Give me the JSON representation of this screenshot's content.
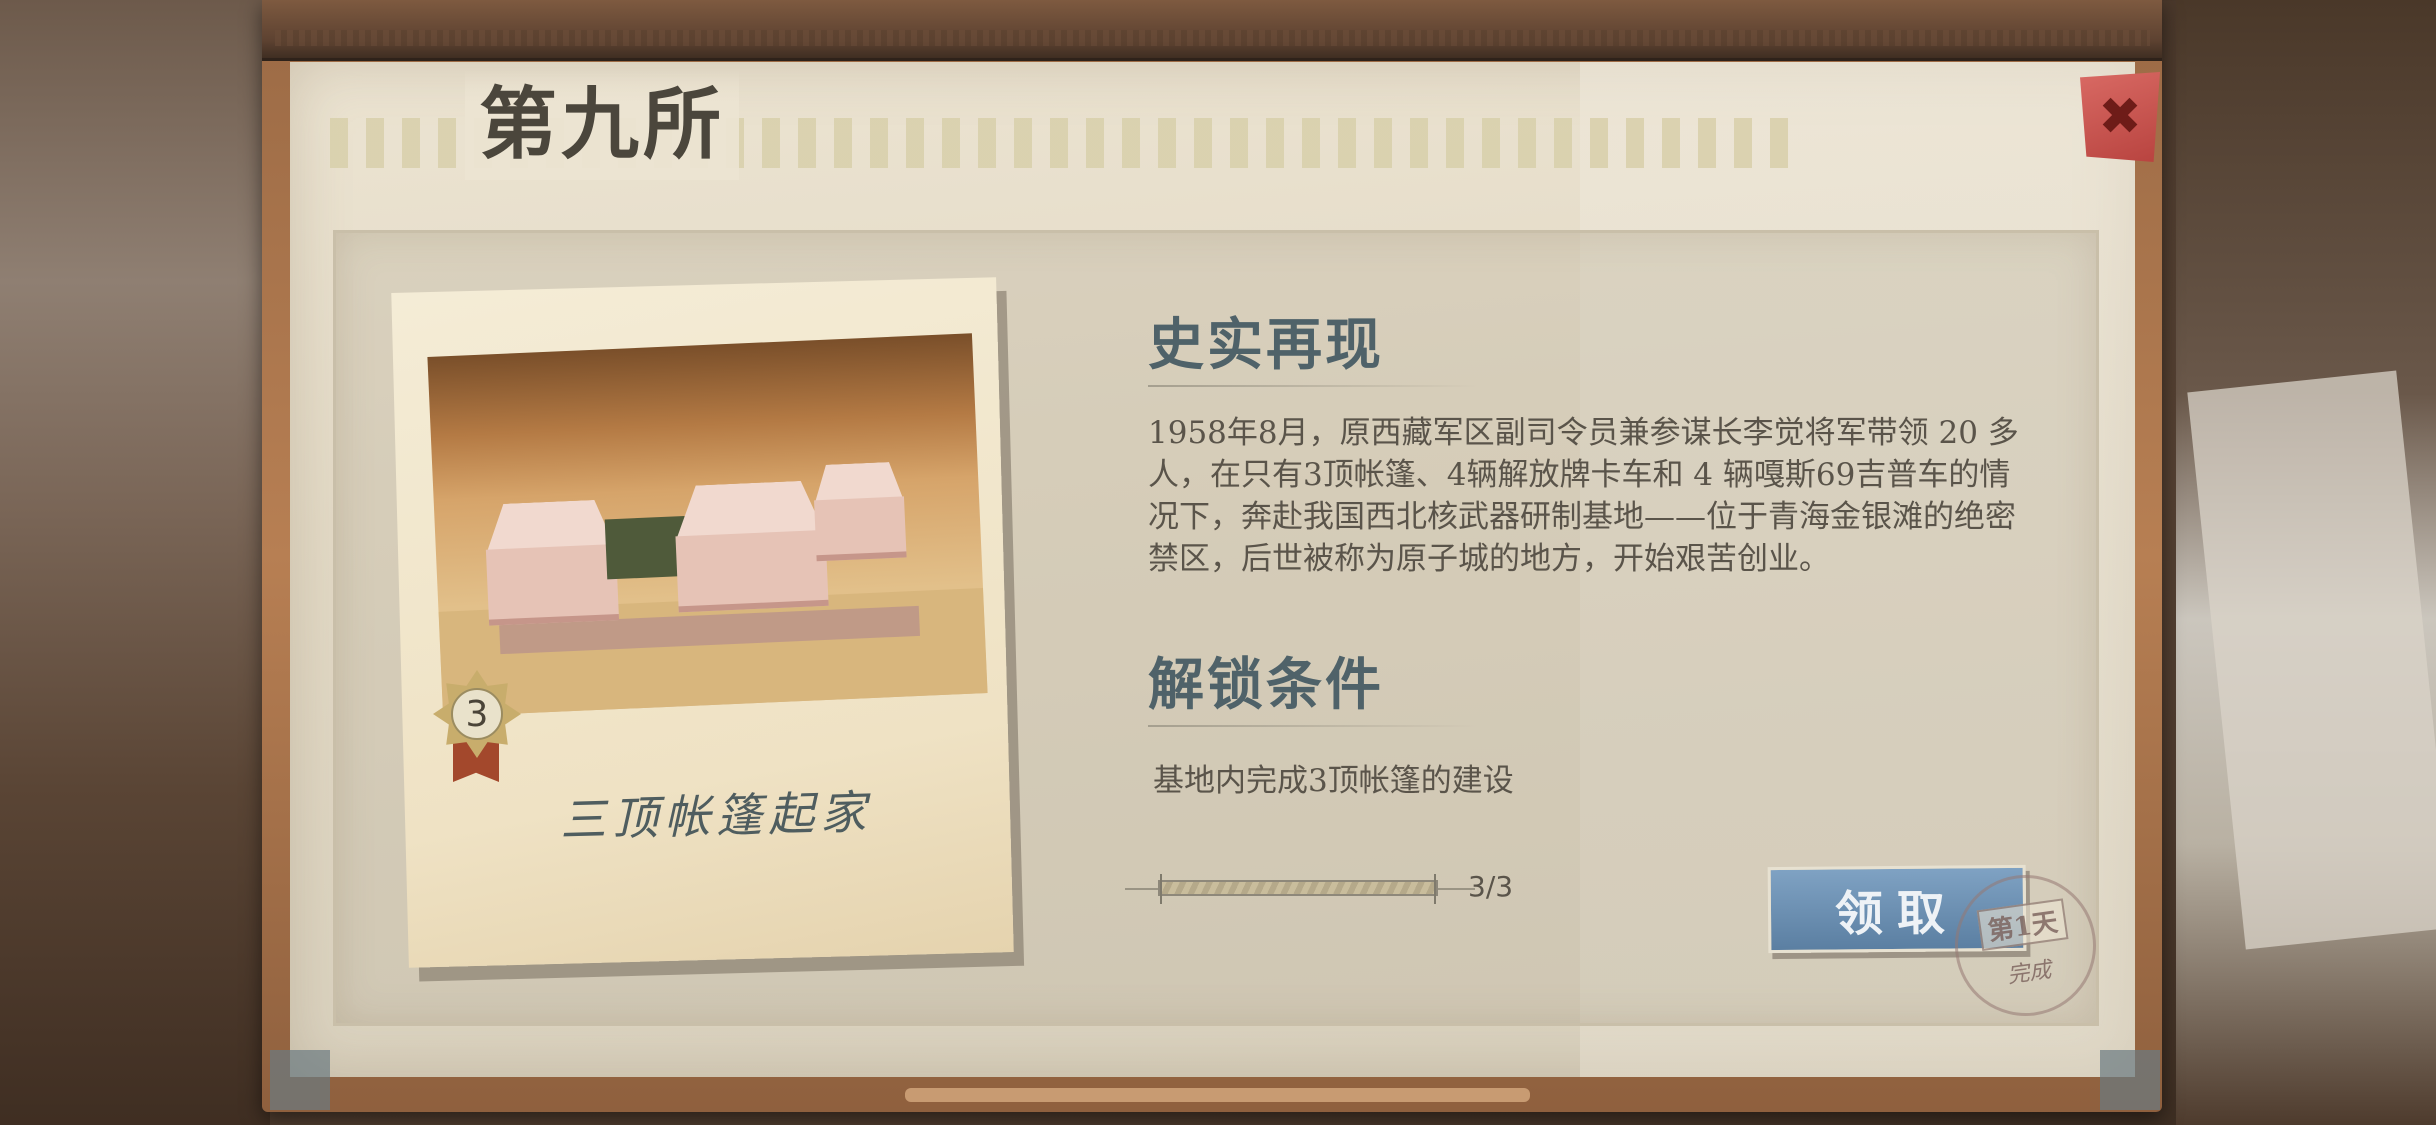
{
  "panel": {
    "title": "第九所",
    "close_icon_glyph": "✖"
  },
  "card": {
    "caption": "三顶帐篷起家",
    "badge_number": "3",
    "photo_description_icon": "tents-photo"
  },
  "history": {
    "heading": "史实再现",
    "text": "1958年8月，原西藏军区副司令员兼参谋长李觉将军带领 20 多人，在只有3顶帐篷、4辆解放牌卡车和 4 辆嘎斯69吉普车的情况下，奔赴我国西北核武器研制基地——位于青海金银滩的绝密禁区，后世被称为原子城的地方，开始艰苦创业。"
  },
  "unlock": {
    "heading": "解锁条件",
    "condition": "基地内完成3顶帐篷的建设",
    "progress_text": "3/3",
    "progress_fraction": 1.0
  },
  "actions": {
    "claim_label": "领取"
  },
  "stamp": {
    "day": "第1天",
    "status": "完成"
  },
  "colors": {
    "heading": "#4f6269",
    "claim_button": "#5b7fa2",
    "close_button": "#b8433f"
  }
}
